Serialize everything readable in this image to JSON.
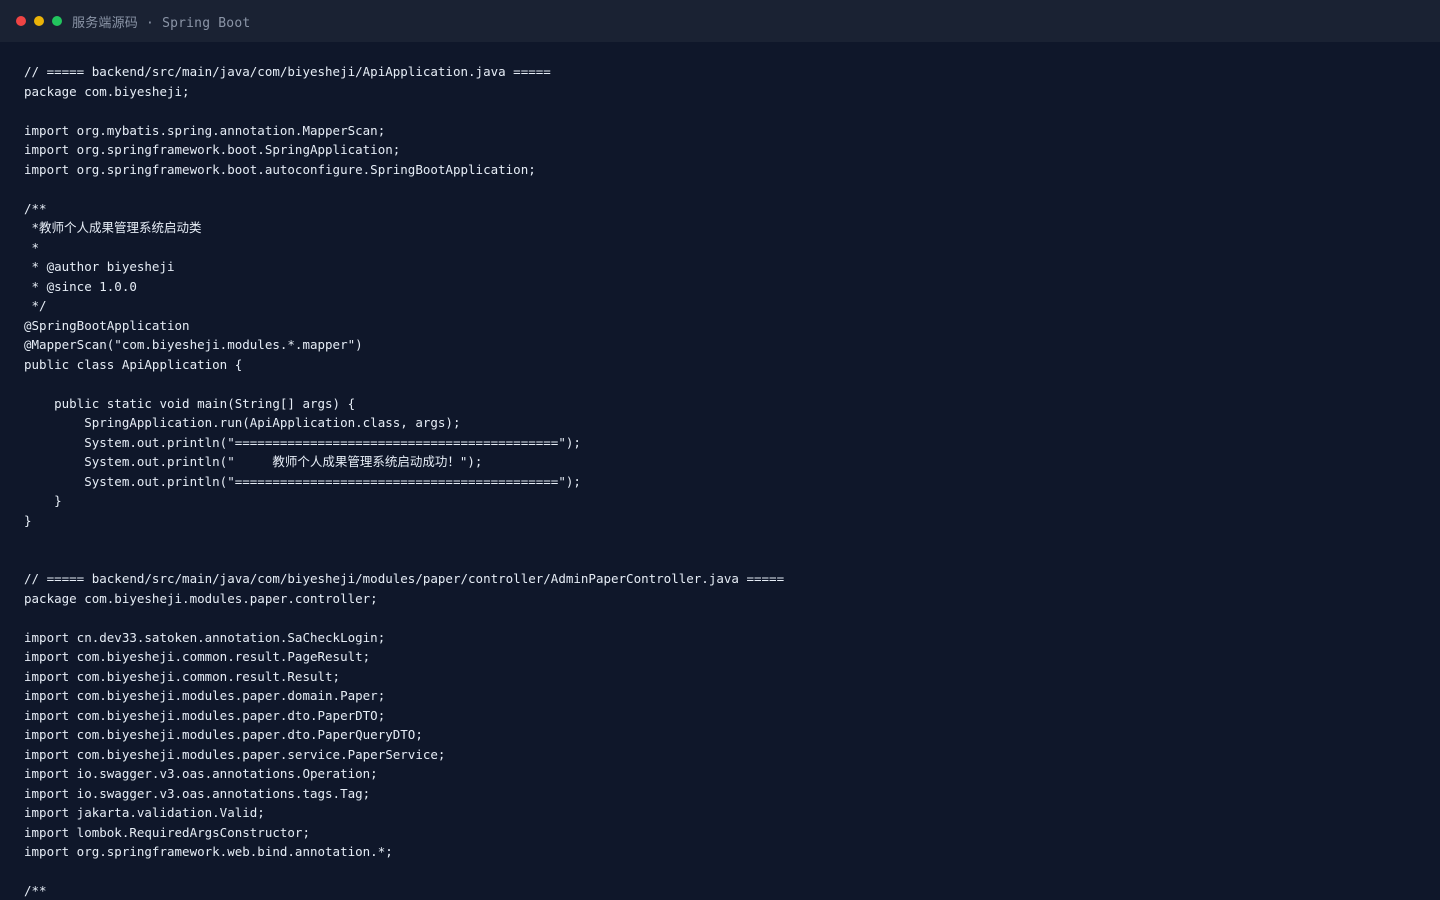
{
  "window": {
    "title": "服务端源码 · Spring Boot",
    "traffic_lights": [
      "close",
      "minimize",
      "zoom"
    ],
    "colors": {
      "background": "#0f172a",
      "titlebar": "#1a2233",
      "close": "#ef4444",
      "minimize": "#eab308",
      "zoom": "#22c55e",
      "code_text": "#e6edf6",
      "title_text": "#8b95a7"
    }
  },
  "code": {
    "lines": [
      "// ===== backend/src/main/java/com/biyesheji/ApiApplication.java =====",
      "package com.biyesheji;",
      "",
      "import org.mybatis.spring.annotation.MapperScan;",
      "import org.springframework.boot.SpringApplication;",
      "import org.springframework.boot.autoconfigure.SpringBootApplication;",
      "",
      "/**",
      " *教师个人成果管理系统启动类",
      " *",
      " * @author biyesheji",
      " * @since 1.0.0",
      " */",
      "@SpringBootApplication",
      "@MapperScan(\"com.biyesheji.modules.*.mapper\")",
      "public class ApiApplication {",
      "",
      "    public static void main(String[] args) {",
      "        SpringApplication.run(ApiApplication.class, args);",
      "        System.out.println(\"===========================================\");",
      "        System.out.println(\"     教师个人成果管理系统启动成功！\");",
      "        System.out.println(\"===========================================\");",
      "    }",
      "}",
      "",
      "",
      "// ===== backend/src/main/java/com/biyesheji/modules/paper/controller/AdminPaperController.java =====",
      "package com.biyesheji.modules.paper.controller;",
      "",
      "import cn.dev33.satoken.annotation.SaCheckLogin;",
      "import com.biyesheji.common.result.PageResult;",
      "import com.biyesheji.common.result.Result;",
      "import com.biyesheji.modules.paper.domain.Paper;",
      "import com.biyesheji.modules.paper.dto.PaperDTO;",
      "import com.biyesheji.modules.paper.dto.PaperQueryDTO;",
      "import com.biyesheji.modules.paper.service.PaperService;",
      "import io.swagger.v3.oas.annotations.Operation;",
      "import io.swagger.v3.oas.annotations.tags.Tag;",
      "import jakarta.validation.Valid;",
      "import lombok.RequiredArgsConstructor;",
      "import org.springframework.web.bind.annotation.*;",
      "",
      "/**"
    ]
  }
}
